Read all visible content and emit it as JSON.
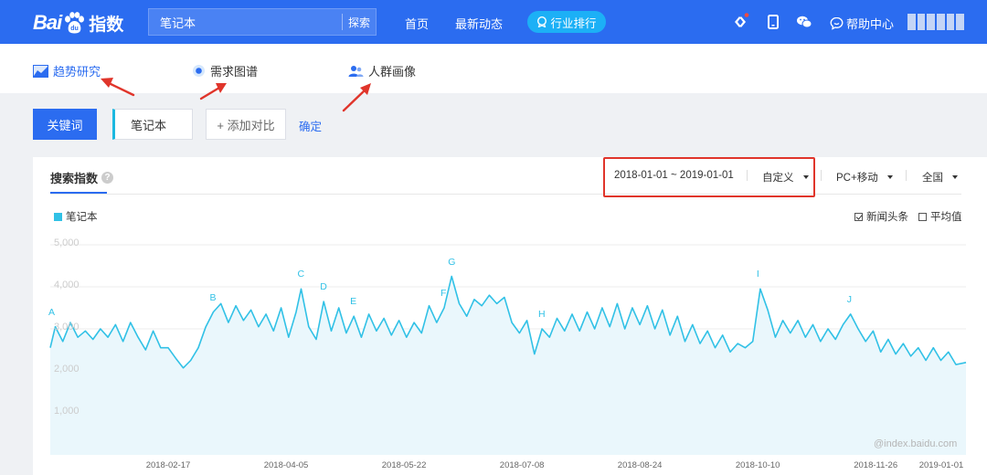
{
  "topbar": {
    "logo_bai": "Bai",
    "logo_du": "du",
    "logo_index": "指数",
    "search_value": "笔记本",
    "search_button": "探索",
    "nav_home": "首页",
    "nav_news": "最新动态",
    "nav_rank": "行业排行",
    "help": "帮助中心",
    "icons": [
      "diamond-icon",
      "phone-icon",
      "wechat-icon",
      "help-bubble-icon"
    ]
  },
  "subnav": {
    "trend": "趋势研究",
    "demand": "需求图谱",
    "crowd": "人群画像"
  },
  "keywords": {
    "type_button": "关键词",
    "keyword": "笔记本",
    "add_compare": "+ 添加对比",
    "confirm": "确定"
  },
  "panel": {
    "title": "搜索指数",
    "help_mark": "?",
    "date_range": "2018-01-01 ~ 2019-01-01",
    "custom": "自定义",
    "device": "PC+移动",
    "region": "全国",
    "legend": "笔记本",
    "news_headlines": "新闻头条",
    "average": "平均值",
    "watermark": "@index.baidu.com"
  },
  "colors": {
    "brand_blue": "#2b6cf0",
    "series": "#31c1e6",
    "area": "#eaf7fc",
    "highlight": "#e0352b"
  },
  "chart_data": {
    "type": "area",
    "series_name": "笔记本",
    "ylim": [
      0,
      5000
    ],
    "yticks": [
      "5,000",
      "4,000",
      "3,000",
      "2,000",
      "1,000"
    ],
    "xticks": [
      "2018-02-17",
      "2018-04-05",
      "2018-05-22",
      "2018-07-08",
      "2018-08-24",
      "2018-10-10",
      "2018-11-26",
      "2019-01-01"
    ],
    "x_start": "2018-01-01",
    "x_end": "2019-01-01",
    "points": [
      [
        "2018-01-01",
        2550
      ],
      [
        "2018-01-03",
        3050
      ],
      [
        "2018-01-06",
        2700
      ],
      [
        "2018-01-09",
        3150
      ],
      [
        "2018-01-12",
        2800
      ],
      [
        "2018-01-15",
        2950
      ],
      [
        "2018-01-18",
        2750
      ],
      [
        "2018-01-21",
        3000
      ],
      [
        "2018-01-24",
        2800
      ],
      [
        "2018-01-27",
        3100
      ],
      [
        "2018-01-30",
        2700
      ],
      [
        "2018-02-02",
        3150
      ],
      [
        "2018-02-05",
        2800
      ],
      [
        "2018-02-08",
        2500
      ],
      [
        "2018-02-11",
        2950
      ],
      [
        "2018-02-14",
        2550
      ],
      [
        "2018-02-17",
        2550
      ],
      [
        "2018-02-20",
        2300
      ],
      [
        "2018-02-23",
        2070
      ],
      [
        "2018-02-26",
        2250
      ],
      [
        "2018-03-01",
        2550
      ],
      [
        "2018-03-04",
        3050
      ],
      [
        "2018-03-07",
        3400
      ],
      [
        "2018-03-10",
        3600
      ],
      [
        "2018-03-13",
        3150
      ],
      [
        "2018-03-16",
        3550
      ],
      [
        "2018-03-19",
        3200
      ],
      [
        "2018-03-22",
        3450
      ],
      [
        "2018-03-25",
        3050
      ],
      [
        "2018-03-28",
        3350
      ],
      [
        "2018-03-31",
        2950
      ],
      [
        "2018-04-03",
        3500
      ],
      [
        "2018-04-06",
        2800
      ],
      [
        "2018-04-09",
        3400
      ],
      [
        "2018-04-11",
        3950
      ],
      [
        "2018-04-14",
        3050
      ],
      [
        "2018-04-17",
        2750
      ],
      [
        "2018-04-20",
        3650
      ],
      [
        "2018-04-23",
        2950
      ],
      [
        "2018-04-26",
        3500
      ],
      [
        "2018-04-29",
        2900
      ],
      [
        "2018-05-02",
        3300
      ],
      [
        "2018-05-05",
        2800
      ],
      [
        "2018-05-08",
        3350
      ],
      [
        "2018-05-11",
        2950
      ],
      [
        "2018-05-14",
        3250
      ],
      [
        "2018-05-17",
        2850
      ],
      [
        "2018-05-20",
        3200
      ],
      [
        "2018-05-23",
        2800
      ],
      [
        "2018-05-26",
        3150
      ],
      [
        "2018-05-29",
        2900
      ],
      [
        "2018-06-01",
        3550
      ],
      [
        "2018-06-04",
        3150
      ],
      [
        "2018-06-07",
        3500
      ],
      [
        "2018-06-10",
        4250
      ],
      [
        "2018-06-13",
        3600
      ],
      [
        "2018-06-16",
        3300
      ],
      [
        "2018-06-19",
        3700
      ],
      [
        "2018-06-22",
        3550
      ],
      [
        "2018-06-25",
        3800
      ],
      [
        "2018-06-28",
        3600
      ],
      [
        "2018-07-01",
        3750
      ],
      [
        "2018-07-04",
        3150
      ],
      [
        "2018-07-07",
        2900
      ],
      [
        "2018-07-10",
        3200
      ],
      [
        "2018-07-13",
        2400
      ],
      [
        "2018-07-16",
        3000
      ],
      [
        "2018-07-19",
        2800
      ],
      [
        "2018-07-22",
        3250
      ],
      [
        "2018-07-25",
        2950
      ],
      [
        "2018-07-28",
        3350
      ],
      [
        "2018-07-31",
        2950
      ],
      [
        "2018-08-03",
        3400
      ],
      [
        "2018-08-06",
        3000
      ],
      [
        "2018-08-09",
        3500
      ],
      [
        "2018-08-12",
        3050
      ],
      [
        "2018-08-15",
        3600
      ],
      [
        "2018-08-18",
        3000
      ],
      [
        "2018-08-21",
        3500
      ],
      [
        "2018-08-24",
        3100
      ],
      [
        "2018-08-27",
        3550
      ],
      [
        "2018-08-30",
        3000
      ],
      [
        "2018-09-02",
        3450
      ],
      [
        "2018-09-05",
        2850
      ],
      [
        "2018-09-08",
        3300
      ],
      [
        "2018-09-11",
        2700
      ],
      [
        "2018-09-14",
        3100
      ],
      [
        "2018-09-17",
        2650
      ],
      [
        "2018-09-20",
        2950
      ],
      [
        "2018-09-23",
        2550
      ],
      [
        "2018-09-26",
        2850
      ],
      [
        "2018-09-29",
        2450
      ],
      [
        "2018-10-02",
        2650
      ],
      [
        "2018-10-05",
        2550
      ],
      [
        "2018-10-08",
        2700
      ],
      [
        "2018-10-11",
        3950
      ],
      [
        "2018-10-14",
        3450
      ],
      [
        "2018-10-17",
        2800
      ],
      [
        "2018-10-20",
        3200
      ],
      [
        "2018-10-23",
        2900
      ],
      [
        "2018-10-26",
        3200
      ],
      [
        "2018-10-29",
        2800
      ],
      [
        "2018-11-01",
        3100
      ],
      [
        "2018-11-04",
        2700
      ],
      [
        "2018-11-07",
        3000
      ],
      [
        "2018-11-10",
        2750
      ],
      [
        "2018-11-13",
        3100
      ],
      [
        "2018-11-16",
        3350
      ],
      [
        "2018-11-19",
        3000
      ],
      [
        "2018-11-22",
        2700
      ],
      [
        "2018-11-25",
        2950
      ],
      [
        "2018-11-28",
        2450
      ],
      [
        "2018-12-01",
        2750
      ],
      [
        "2018-12-04",
        2400
      ],
      [
        "2018-12-07",
        2650
      ],
      [
        "2018-12-10",
        2350
      ],
      [
        "2018-12-13",
        2550
      ],
      [
        "2018-12-16",
        2250
      ],
      [
        "2018-12-19",
        2550
      ],
      [
        "2018-12-22",
        2250
      ],
      [
        "2018-12-25",
        2450
      ],
      [
        "2018-12-28",
        2150
      ],
      [
        "2019-01-01",
        2200
      ]
    ],
    "annotations": [
      {
        "label": "A",
        "date": "2018-01-01",
        "value": 3050
      },
      {
        "label": "B",
        "date": "2018-03-07",
        "value": 3400
      },
      {
        "label": "C",
        "date": "2018-04-11",
        "value": 3950
      },
      {
        "label": "D",
        "date": "2018-04-20",
        "value": 3650
      },
      {
        "label": "E",
        "date": "2018-05-02",
        "value": 3300
      },
      {
        "label": "F",
        "date": "2018-06-07",
        "value": 3500
      },
      {
        "label": "G",
        "date": "2018-06-10",
        "value": 4250
      },
      {
        "label": "H",
        "date": "2018-07-16",
        "value": 3000
      },
      {
        "label": "I",
        "date": "2018-10-11",
        "value": 3950
      },
      {
        "label": "J",
        "date": "2018-11-16",
        "value": 3350
      }
    ]
  }
}
